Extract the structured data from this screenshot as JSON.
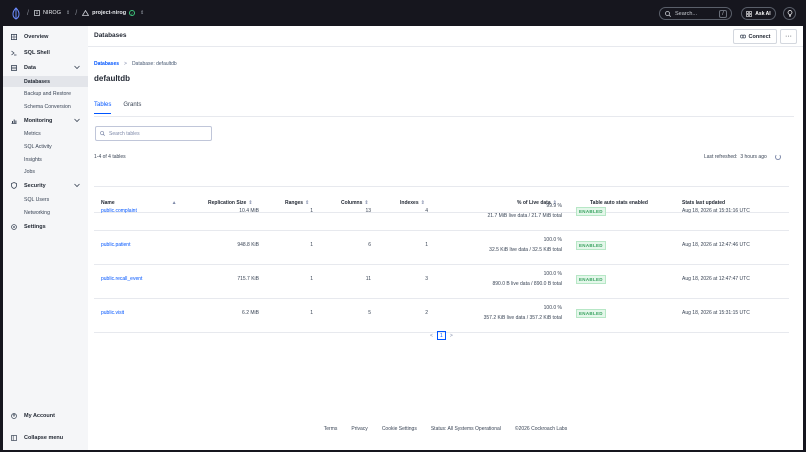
{
  "topbar": {
    "org": "NIROG",
    "project": "project-nirog",
    "search_placeholder": "Search...",
    "search_shortcut": "/",
    "ask_ai": "Ask AI"
  },
  "sidebar": {
    "overview": "Overview",
    "sql_shell": "SQL Shell",
    "data": "Data",
    "databases": "Databases",
    "backup_restore": "Backup and Restore",
    "schema_conversion": "Schema Conversion",
    "monitoring": "Monitoring",
    "metrics": "Metrics",
    "sql_activity": "SQL Activity",
    "insights": "Insights",
    "jobs": "Jobs",
    "security": "Security",
    "sql_users": "SQL Users",
    "networking": "Networking",
    "settings": "Settings",
    "my_account": "My Account",
    "collapse_menu": "Collapse menu"
  },
  "header": {
    "title": "Databases",
    "connect": "Connect",
    "more": "···"
  },
  "breadcrumb": {
    "root": "Databases",
    "sep": ">",
    "current": "Database: defaultdb"
  },
  "page_title": "defaultdb",
  "tabs": [
    "Tables",
    "Grants"
  ],
  "search_tables_placeholder": "Search tables",
  "count_text": "1-4 of 4 tables",
  "last_refreshed_label": "Last refreshed:",
  "last_refreshed_value": "3 hours ago",
  "columns": {
    "name": "Name",
    "replication_size": "Replication Size",
    "ranges": "Ranges",
    "columns": "Columns",
    "indexes": "Indexes",
    "live_data": "% of Live data",
    "auto_stats": "Table auto stats enabled",
    "stats_updated": "Stats last updated"
  },
  "rows": [
    {
      "name": "public.complaint",
      "size": "10.4 MiB",
      "ranges": "1",
      "columns": "13",
      "indexes": "4",
      "live_pct": "99.9 %",
      "live_detail": "21.7 MiB live data / 21.7 MiB total",
      "auto_stats": "ENABLED",
      "updated": "Aug 18, 2026 at 15:31:16 UTC"
    },
    {
      "name": "public.patient",
      "size": "948.8 KiB",
      "ranges": "1",
      "columns": "6",
      "indexes": "1",
      "live_pct": "100.0 %",
      "live_detail": "32.5 KiB live data / 32.5 KiB total",
      "auto_stats": "ENABLED",
      "updated": "Aug 18, 2026 at 12:47:46 UTC"
    },
    {
      "name": "public.recall_event",
      "size": "715.7 KiB",
      "ranges": "1",
      "columns": "11",
      "indexes": "3",
      "live_pct": "100.0 %",
      "live_detail": "890.0 B live data / 890.0 B total",
      "auto_stats": "ENABLED",
      "updated": "Aug 18, 2026 at 12:47:47 UTC"
    },
    {
      "name": "public.visit",
      "size": "6.2 MiB",
      "ranges": "1",
      "columns": "5",
      "indexes": "2",
      "live_pct": "100.0 %",
      "live_detail": "357.2 KiB live data / 357.2 KiB total",
      "auto_stats": "ENABLED",
      "updated": "Aug 18, 2026 at 15:31:15 UTC"
    }
  ],
  "pager": {
    "prev": "<",
    "page": "1",
    "next": ">"
  },
  "footer": [
    "Terms",
    "Privacy",
    "Cookie Settings",
    "Status: All Systems Operational",
    "©2026 Cockroach Labs"
  ],
  "colors": {
    "accent": "#0055ff",
    "badge_green": "#36a15e",
    "topbar_bg": "#16161e"
  }
}
